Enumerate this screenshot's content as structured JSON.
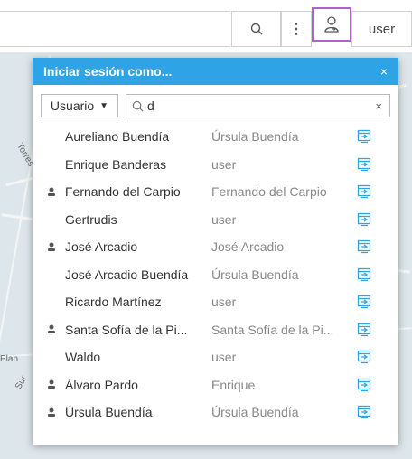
{
  "toolbar": {
    "search_icon": "search-icon",
    "more_label": "⋮",
    "user_icon": "user-switch-icon",
    "user_label": "user"
  },
  "popup": {
    "title": "Iniciar sesión como...",
    "close_label": "×",
    "filter_type_label": "Usuario",
    "search_value": "d",
    "clear_label": "×",
    "accent_color": "#2ea4e6",
    "rows": [
      {
        "name": "Aureliano Buendía",
        "assoc": "Úrsula Buendía",
        "pinned": false
      },
      {
        "name": "Enrique Banderas",
        "assoc": "user",
        "pinned": false
      },
      {
        "name": "Fernando del Carpio",
        "assoc": "Fernando del Carpio",
        "pinned": true
      },
      {
        "name": "Gertrudis",
        "assoc": "user",
        "pinned": false
      },
      {
        "name": "José Arcadio",
        "assoc": "José Arcadio",
        "pinned": true
      },
      {
        "name": "José Arcadio Buendía",
        "assoc": "Úrsula Buendía",
        "pinned": false
      },
      {
        "name": "Ricardo Martínez",
        "assoc": "user",
        "pinned": false
      },
      {
        "name": "Santa Sofía de la Pi...",
        "assoc": "Santa Sofía de la Pi...",
        "pinned": true
      },
      {
        "name": "Waldo",
        "assoc": "user",
        "pinned": false
      },
      {
        "name": "Álvaro Pardo",
        "assoc": "Enrique",
        "pinned": true
      },
      {
        "name": "Úrsula Buendía",
        "assoc": "Úrsula Buendía",
        "pinned": true
      }
    ]
  },
  "map": {
    "labels": [
      "Torres",
      "Plan",
      "Sur"
    ]
  }
}
